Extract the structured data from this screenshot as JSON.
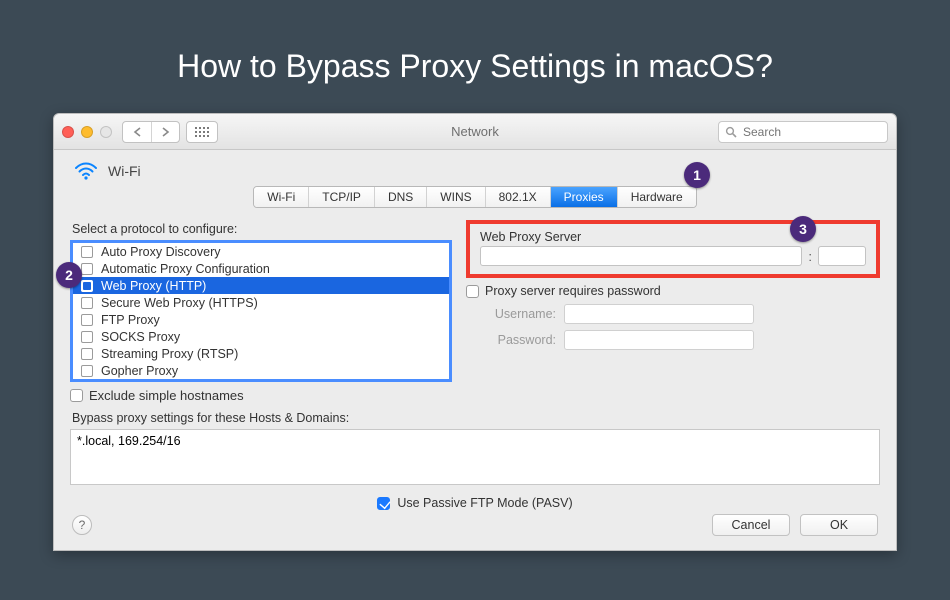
{
  "hero": {
    "title": "How to Bypass Proxy Settings in macOS?"
  },
  "window": {
    "title": "Network",
    "search_placeholder": "Search"
  },
  "sidebar": {
    "network_name": "Wi-Fi"
  },
  "tabs": [
    "Wi-Fi",
    "TCP/IP",
    "DNS",
    "WINS",
    "802.1X",
    "Proxies",
    "Hardware"
  ],
  "active_tab_index": 5,
  "annotations": {
    "b1": "1",
    "b2": "2",
    "b3": "3"
  },
  "protocols": {
    "label": "Select a protocol to configure:",
    "items": [
      {
        "label": "Auto Proxy Discovery",
        "checked": false
      },
      {
        "label": "Automatic Proxy Configuration",
        "checked": false
      },
      {
        "label": "Web Proxy (HTTP)",
        "checked": true
      },
      {
        "label": "Secure Web Proxy (HTTPS)",
        "checked": false
      },
      {
        "label": "FTP Proxy",
        "checked": false
      },
      {
        "label": "SOCKS Proxy",
        "checked": false
      },
      {
        "label": "Streaming Proxy (RTSP)",
        "checked": false
      },
      {
        "label": "Gopher Proxy",
        "checked": false
      }
    ],
    "selected_index": 2
  },
  "exclude": {
    "label": "Exclude simple hostnames",
    "checked": false
  },
  "server": {
    "title": "Web Proxy Server",
    "host": "",
    "port": "",
    "requires_password_label": "Proxy server requires password",
    "requires_password": false,
    "username_label": "Username:",
    "password_label": "Password:",
    "username": "",
    "password": ""
  },
  "bypass": {
    "label": "Bypass proxy settings for these Hosts & Domains:",
    "value": "*.local, 169.254/16"
  },
  "pasv": {
    "label": "Use Passive FTP Mode (PASV)",
    "checked": true
  },
  "buttons": {
    "cancel": "Cancel",
    "ok": "OK"
  }
}
